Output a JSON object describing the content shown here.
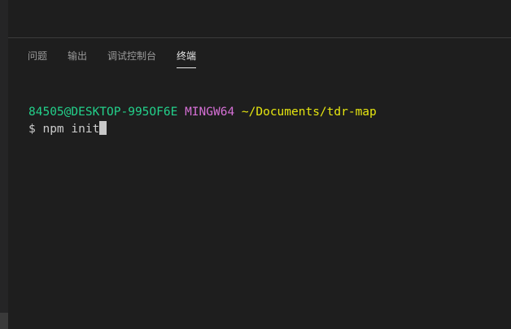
{
  "panel": {
    "tabs": [
      {
        "label": "问题",
        "active": false
      },
      {
        "label": "输出",
        "active": false
      },
      {
        "label": "调试控制台",
        "active": false
      },
      {
        "label": "终端",
        "active": true
      }
    ]
  },
  "terminal": {
    "user_host": "84505@DESKTOP-995OF6E",
    "shell": "MINGW64",
    "path": "~/Documents/tdr-map",
    "prompt": "$",
    "command": "npm init"
  },
  "colors": {
    "background": "#1e1e1e",
    "user_host": "#23d18b",
    "shell": "#d670d6",
    "path": "#e5e510"
  }
}
